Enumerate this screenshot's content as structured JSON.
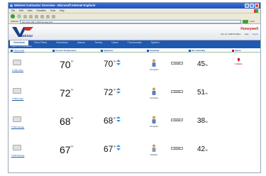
{
  "window": {
    "title": "Webnet Contractor Overview - Microsoft Internet Explorer"
  },
  "menus": [
    "File",
    "Edit",
    "View",
    "Favorites",
    "Tools",
    "Help"
  ],
  "address": {
    "label": "Address",
    "url": "http://192.168.1.100/Overview.html",
    "links": "Links"
  },
  "brand": {
    "name": "Honeywell",
    "product": "WebStat"
  },
  "header": {
    "datetime": "Dec 24, 2008 06:38am",
    "help": "Help",
    "logout": "Logout"
  },
  "nav": {
    "tabs": [
      "Overview",
      "Floor Plans",
      "Schedules",
      "Alarms",
      "Trends",
      "Users",
      "Thermostats",
      "System"
    ],
    "sub": "Logged in as: Equallatitas"
  },
  "columns": {
    "thermostat": "Thermostat",
    "current_temp": "Current Temperature",
    "setpoints": "Setpoints",
    "schedule": "Schedule",
    "humidity": "Rel. Humidity",
    "alarm": "Alarm"
  },
  "rows": [
    {
      "name": "T7350 Office",
      "temp": "70",
      "temp_unit": "°F",
      "setpoint": "70",
      "sp_unit": "°F",
      "schedule": "Occupied",
      "override": "Override",
      "humidity": "45",
      "hum_unit": "%",
      "alarm": "1 Alarm"
    },
    {
      "name": "T7350 Lobby",
      "temp": "72",
      "temp_unit": "°F",
      "setpoint": "72",
      "sp_unit": "°F",
      "schedule": "Occupied",
      "override": "Override",
      "humidity": "51",
      "hum_unit": "%",
      "alarm": ""
    },
    {
      "name": "T7350 Storage",
      "temp": "68",
      "temp_unit": "°F",
      "setpoint": "68",
      "sp_unit": "°F",
      "schedule": "Occupied",
      "override": "Override",
      "humidity": "38",
      "hum_unit": "%",
      "alarm": ""
    },
    {
      "name": "T7350 Meeting",
      "temp": "67",
      "temp_unit": "°F",
      "setpoint": "67",
      "sp_unit": "°F",
      "schedule": "Standby",
      "override": "Override",
      "humidity": "42",
      "hum_unit": "%",
      "alarm": ""
    }
  ],
  "colors": {
    "nav": "#1f5ab0",
    "brand": "#cc1d1d",
    "link": "#1f5aa6",
    "alarm": "#c21d1d"
  }
}
